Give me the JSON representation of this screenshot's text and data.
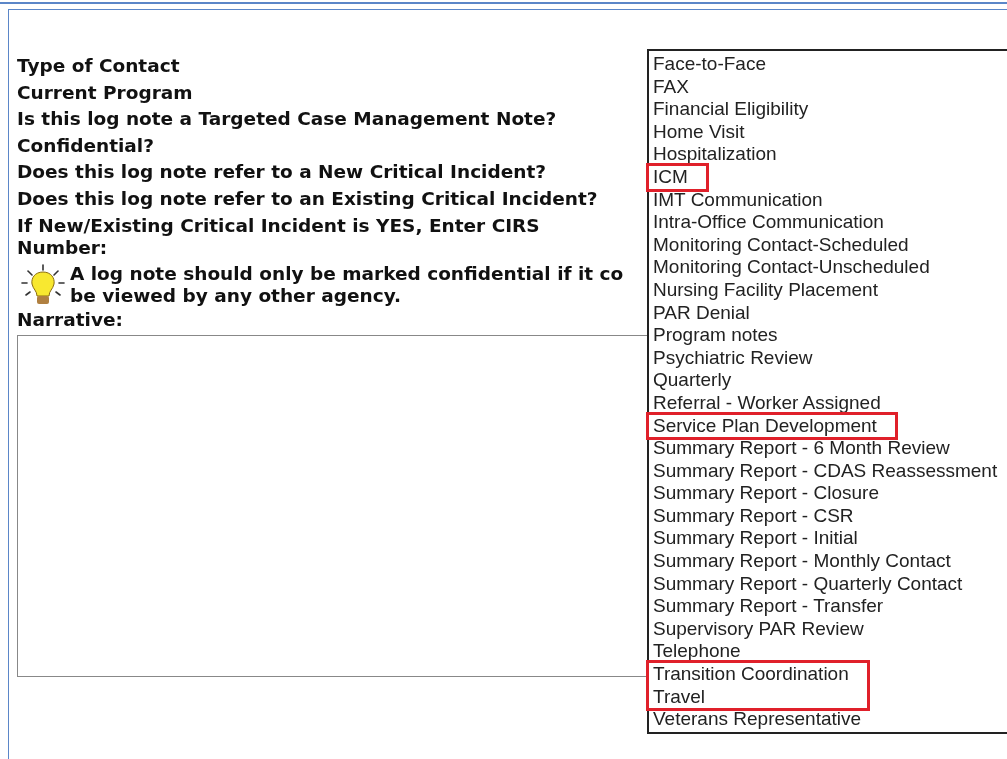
{
  "form": {
    "labels": [
      {
        "text": "Type of Contact"
      },
      {
        "text": "Current Program"
      },
      {
        "text": "Is this log note a Targeted Case Management Note?"
      },
      {
        "text": "Confidential?"
      },
      {
        "text": "Does this log note refer to a New Critical Incident?"
      },
      {
        "text": "Does this log note refer to an Existing Critical Incident?"
      },
      {
        "text": "If New/Existing Critical Incident is YES, Enter CIRS Number:"
      }
    ],
    "tip": "A log note should only be marked confidential if it co",
    "tip_line_2": "be viewed by any other agency.",
    "narrative_label": "Narrative:"
  },
  "dropdown": {
    "options": [
      {
        "label": "Face-to-Face",
        "highlighted": false
      },
      {
        "label": "FAX",
        "highlighted": false
      },
      {
        "label": "Financial Eligibility",
        "highlighted": false
      },
      {
        "label": "Home Visit",
        "highlighted": false
      },
      {
        "label": "Hospitalization",
        "highlighted": false
      },
      {
        "label": "ICM",
        "highlighted": true
      },
      {
        "label": "IMT Communication",
        "highlighted": false
      },
      {
        "label": "Intra-Office Communication",
        "highlighted": false
      },
      {
        "label": "Monitoring Contact-Scheduled",
        "highlighted": false
      },
      {
        "label": "Monitoring Contact-Unscheduled",
        "highlighted": false
      },
      {
        "label": "Nursing Facility Placement",
        "highlighted": false
      },
      {
        "label": "PAR Denial",
        "highlighted": false
      },
      {
        "label": "Program notes",
        "highlighted": false
      },
      {
        "label": "Psychiatric Review",
        "highlighted": false
      },
      {
        "label": "Quarterly",
        "highlighted": false
      },
      {
        "label": "Referral - Worker Assigned",
        "highlighted": false
      },
      {
        "label": "Service Plan Development",
        "highlighted": true
      },
      {
        "label": "Summary Report - 6 Month Review",
        "highlighted": false
      },
      {
        "label": "Summary Report - CDAS Reassessment",
        "highlighted": false
      },
      {
        "label": "Summary Report - Closure",
        "highlighted": false
      },
      {
        "label": "Summary Report - CSR",
        "highlighted": false
      },
      {
        "label": "Summary Report - Initial",
        "highlighted": false
      },
      {
        "label": "Summary Report - Monthly Contact",
        "highlighted": false
      },
      {
        "label": "Summary Report - Quarterly Contact",
        "highlighted": false
      },
      {
        "label": "Summary Report - Transfer",
        "highlighted": false
      },
      {
        "label": "Supervisory PAR Review",
        "highlighted": false
      },
      {
        "label": "Telephone",
        "highlighted": false
      },
      {
        "label": "Transition Coordination",
        "highlighted": true
      },
      {
        "label": "Travel",
        "highlighted": true
      },
      {
        "label": "Veterans Representative",
        "highlighted": false
      }
    ]
  }
}
